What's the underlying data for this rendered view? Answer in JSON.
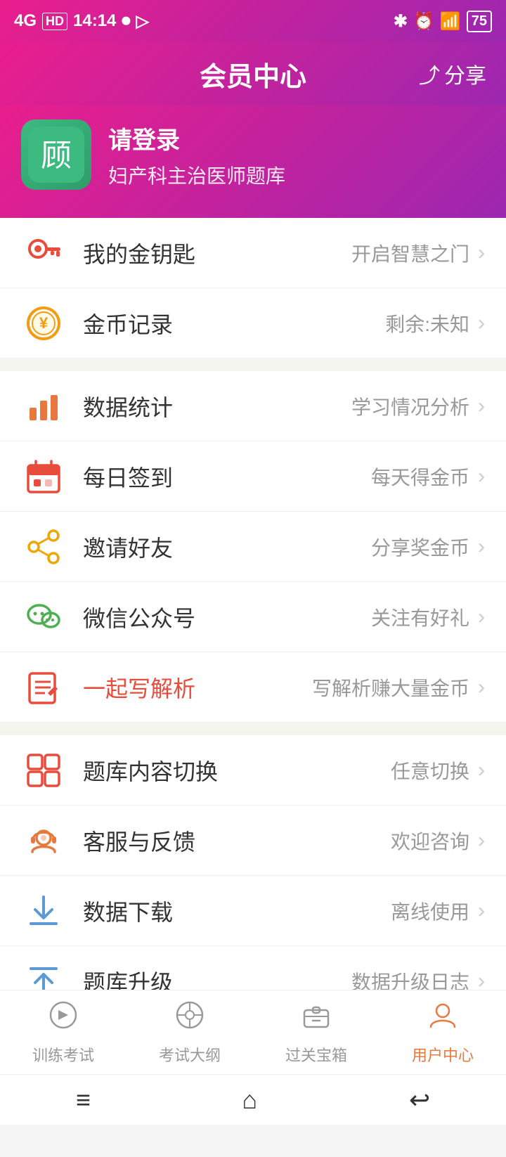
{
  "statusBar": {
    "signal": "4G",
    "hd": "HD",
    "time": "14:14",
    "bluetooth": "⊕",
    "battery": "75"
  },
  "header": {
    "title": "会员中心",
    "share": "分享"
  },
  "profile": {
    "loginText": "请登录",
    "subtitle": "妇产科主治医师题库"
  },
  "menuItems": [
    {
      "id": "golden-key",
      "label": "我的金钥匙",
      "sub": "开启智慧之门",
      "icon": "key"
    },
    {
      "id": "coin-record",
      "label": "金币记录",
      "sub": "剩余:未知",
      "icon": "coin"
    }
  ],
  "menuItems2": [
    {
      "id": "data-stats",
      "label": "数据统计",
      "sub": "学习情况分析",
      "icon": "chart"
    },
    {
      "id": "daily-sign",
      "label": "每日签到",
      "sub": "每天得金币",
      "icon": "calendar"
    },
    {
      "id": "invite",
      "label": "邀请好友",
      "sub": "分享奖金币",
      "icon": "share"
    },
    {
      "id": "wechat",
      "label": "微信公众号",
      "sub": "关注有好礼",
      "icon": "wechat"
    },
    {
      "id": "write-analysis",
      "label": "一起写解析",
      "sub": "写解析赚大量金币",
      "icon": "write",
      "highlight": true
    }
  ],
  "menuItems3": [
    {
      "id": "switch-bank",
      "label": "题库内容切换",
      "sub": "任意切换",
      "icon": "switch"
    },
    {
      "id": "service",
      "label": "客服与反馈",
      "sub": "欢迎咨询",
      "icon": "service"
    },
    {
      "id": "download",
      "label": "数据下载",
      "sub": "离线使用",
      "icon": "download"
    },
    {
      "id": "upgrade",
      "label": "题库升级",
      "sub": "数据升级日志",
      "icon": "upgrade"
    }
  ],
  "bottomNav": [
    {
      "id": "train",
      "label": "训练考试",
      "active": false
    },
    {
      "id": "outline",
      "label": "考试大纲",
      "active": false
    },
    {
      "id": "treasure",
      "label": "过关宝箱",
      "active": false
    },
    {
      "id": "user",
      "label": "用户中心",
      "active": true
    }
  ],
  "systemNav": {
    "menu": "≡",
    "home": "⌂",
    "back": "↩"
  }
}
